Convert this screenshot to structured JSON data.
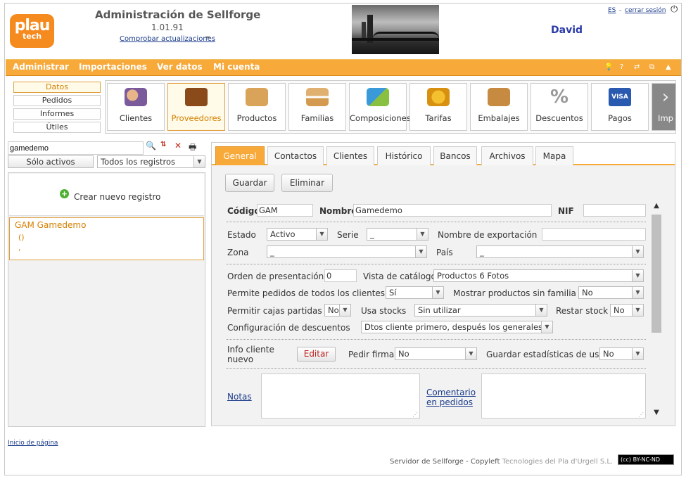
{
  "header": {
    "logo_line1": "plau",
    "logo_line2": "tech",
    "app_title": "Administración de Sellforge",
    "version": "1.01.91",
    "check_updates": "Comprobar actualizaciones",
    "updates_icon": "🗕",
    "user_name": "David",
    "language": "ES",
    "separator": "-",
    "logout": "cerrar sesión",
    "power_icon": "⏻"
  },
  "menubar": {
    "items": [
      "Administrar",
      "Importaciones",
      "Ver datos",
      "Mi cuenta"
    ],
    "icons": [
      "💡",
      "?",
      "⇄",
      "⧉",
      "▲"
    ]
  },
  "left_nav": {
    "items": [
      "Datos",
      "Pedidos",
      "Informes",
      "Útiles"
    ],
    "active": "Datos"
  },
  "modules": {
    "items": [
      "Clientes",
      "Proveedores",
      "Productos",
      "Familias",
      "Composiciones",
      "Tarifas",
      "Embalajes",
      "Descuentos",
      "Pagos",
      "Imp"
    ],
    "active": "Proveedores"
  },
  "search": {
    "value": "gamedemo",
    "active_only_label": "Sólo activos",
    "filter_value": "Todos los registros"
  },
  "records": {
    "new_record_label": "Crear nuevo registro",
    "selected_name": "GAM Gamedemo",
    "selected_line2": "()",
    "selected_line3": ","
  },
  "tabs": [
    "General",
    "Contactos",
    "Clientes",
    "Histórico",
    "Bancos",
    "Archivos",
    "Mapa"
  ],
  "actions": {
    "save": "Guardar",
    "delete": "Eliminar"
  },
  "form": {
    "codigo_label": "Código",
    "codigo_value": "GAM",
    "nombre_label": "Nombre",
    "nombre_value": "Gamedemo",
    "nif_label": "NIF",
    "nif_value": "",
    "estado_label": "Estado",
    "estado_value": "Activo",
    "serie_label": "Serie",
    "serie_value": "_",
    "nombre_export_label": "Nombre de exportación",
    "nombre_export_value": "",
    "zona_label": "Zona",
    "zona_value": "_",
    "pais_label": "País",
    "pais_value": "_",
    "orden_label": "Orden de presentación",
    "orden_value": "0",
    "vista_label": "Vista de catálogo",
    "vista_value": "Productos 6 Fotos",
    "permite_pedidos_label": "Permite pedidos de todos los clientes",
    "permite_pedidos_value": "Sí",
    "mostrar_sin_familia_label": "Mostrar productos sin familia",
    "mostrar_sin_familia_value": "No",
    "cajas_label": "Permitir cajas partidas",
    "cajas_value": "No",
    "usa_stocks_label": "Usa stocks",
    "usa_stocks_value": "Sin utilizar",
    "restar_stock_label": "Restar stock",
    "restar_stock_value": "No",
    "config_desc_label": "Configuración de descuentos",
    "config_desc_value": "Dtos cliente primero, después los generales",
    "info_cliente_label_1": "Info cliente",
    "info_cliente_label_2": "nuevo",
    "editar_label": "Editar",
    "pedir_firma_label": "Pedir firma",
    "pedir_firma_value": "No",
    "guardar_estad_label": "Guardar estadísticas de uso",
    "guardar_estad_value": "No",
    "notas_label": "Notas",
    "comentario_label_1": "Comentario",
    "comentario_label_2": "en pedidos"
  },
  "footer": {
    "top_link": "Inicio de página",
    "server_text": "Servidor de Sellforge - Copyleft",
    "company": "Tecnologies del Pla d'Urgell S.L.",
    "license": "(cc) BY-NC-ND"
  },
  "colors": {
    "accent": "#f7a93a",
    "active_text": "#d47f00",
    "link": "#1a3a8a",
    "user": "#2a3aa8"
  }
}
